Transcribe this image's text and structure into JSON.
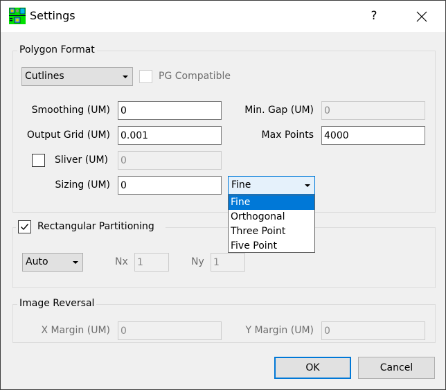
{
  "window": {
    "title": "Settings",
    "help_label": "?",
    "icons": {
      "app": "app-icon",
      "help": "help-icon",
      "close": "close-icon"
    }
  },
  "polygon_format": {
    "group_title": "Polygon Format",
    "format_combo": {
      "value": "Cutlines"
    },
    "pg_compatible": {
      "label": "PG Compatible",
      "checked": false,
      "enabled": false
    },
    "smoothing": {
      "label": "Smoothing (UM)",
      "value": "0"
    },
    "output_grid": {
      "label": "Output Grid (UM)",
      "value": "0.001"
    },
    "sliver": {
      "label": "Sliver (UM)",
      "checked": false,
      "value": "0",
      "enabled": false
    },
    "sizing": {
      "label": "Sizing (UM)",
      "value": "0"
    },
    "min_gap": {
      "label": "Min. Gap (UM)",
      "value": "0",
      "enabled": false
    },
    "max_points": {
      "label": "Max Points",
      "value": "4000"
    },
    "sizing_mode_combo": {
      "value": "Fine",
      "open": true,
      "options": [
        "Fine",
        "Orthogonal",
        "Three Point",
        "Five Point"
      ],
      "highlighted": "Fine"
    }
  },
  "rectangular_partitioning": {
    "label": "Rectangular Partitioning",
    "checked": true,
    "mode_combo": {
      "value": "Auto"
    },
    "nx": {
      "label": "Nx",
      "value": "1",
      "enabled": false
    },
    "ny": {
      "label": "Ny",
      "value": "1",
      "enabled": false
    }
  },
  "image_reversal": {
    "group_title": "Image Reversal",
    "x_margin": {
      "label": "X Margin (UM)",
      "value": "0",
      "enabled": false
    },
    "y_margin": {
      "label": "Y Margin (UM)",
      "value": "0",
      "enabled": false
    }
  },
  "buttons": {
    "ok": "OK",
    "cancel": "Cancel"
  },
  "colors": {
    "accent": "#0078d7",
    "background": "#f0f0f0",
    "disabled_text": "#6d6d6d"
  }
}
